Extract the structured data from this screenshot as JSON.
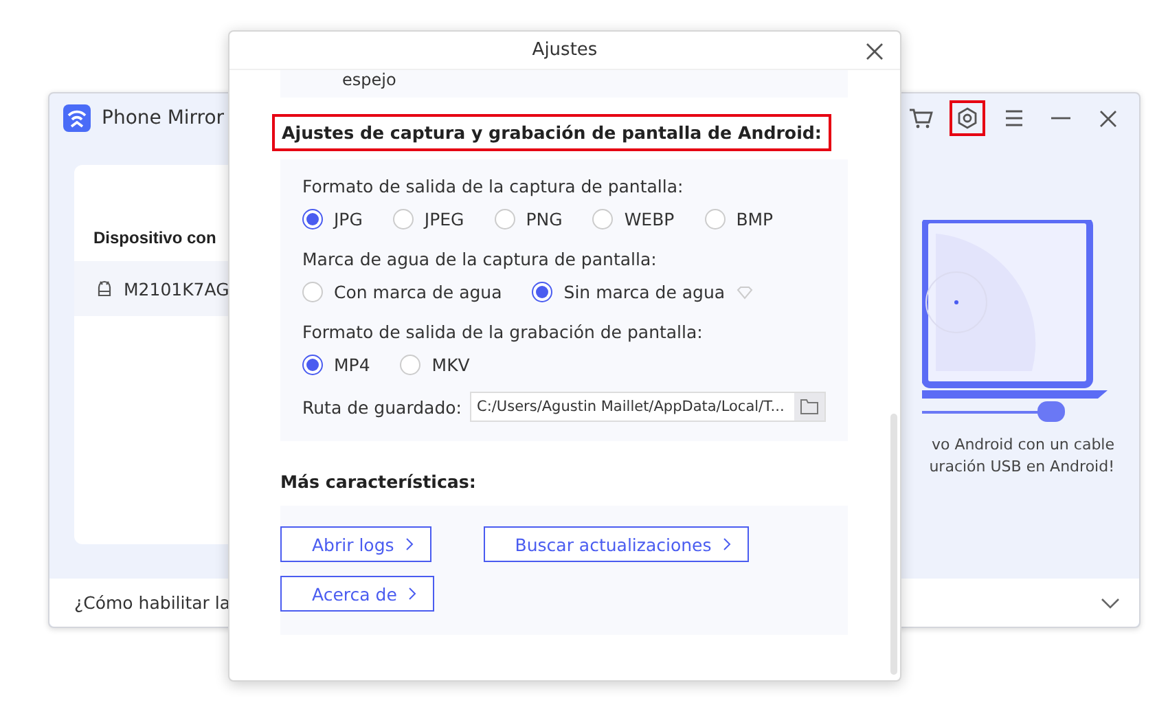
{
  "app": {
    "title": "Phone Mirror",
    "toolbar": [
      {
        "kind": "cart",
        "highlighted": false
      },
      {
        "kind": "settings",
        "highlighted": true
      },
      {
        "kind": "menu",
        "highlighted": false
      },
      {
        "kind": "minimize",
        "highlighted": false
      },
      {
        "kind": "close",
        "highlighted": false
      }
    ],
    "device_heading": "Dispositivo con",
    "device": "M2101K7AG",
    "hint_lines": [
      "vo Android con un cable",
      "uración USB en Android!"
    ],
    "footer": "¿Cómo habilitar la"
  },
  "dialog": {
    "title": "Ajustes",
    "top_text": "espejo",
    "section": {
      "title": "Ajustes de captura y grabación de pantalla de Android:",
      "highlighted": true
    },
    "groups": [
      {
        "label": "Formato de salida de la captura de pantalla:",
        "options": [
          {
            "label": "JPG",
            "selected": true
          },
          {
            "label": "JPEG",
            "selected": false
          },
          {
            "label": "PNG",
            "selected": false
          },
          {
            "label": "WEBP",
            "selected": false
          },
          {
            "label": "BMP",
            "selected": false
          }
        ]
      },
      {
        "label": "Marca de agua de la captura de pantalla:",
        "options": [
          {
            "label": "Con marca de agua",
            "selected": false
          },
          {
            "label": "Sin marca de agua",
            "selected": true,
            "premium": true
          }
        ]
      },
      {
        "label": "Formato de salida de la grabación de pantalla:",
        "options": [
          {
            "label": "MP4",
            "selected": true
          },
          {
            "label": "MKV",
            "selected": false
          }
        ]
      }
    ],
    "path_label": "Ruta de guardado:",
    "path_value": "C:/Users/Agustin Maillet/AppData/Local/T...",
    "more_title": "Más características:",
    "buttons": [
      [
        "Abrir logs",
        "Buscar actualizaciones"
      ],
      [
        "Acerca de"
      ]
    ]
  }
}
